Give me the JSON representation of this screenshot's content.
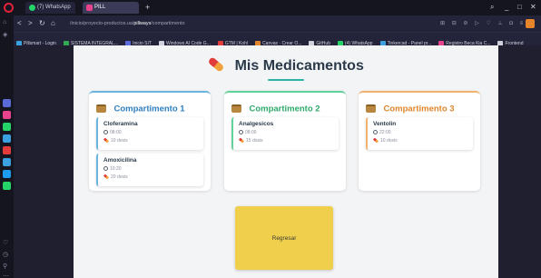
{
  "browser": {
    "tabs": [
      {
        "label": "(7) WhatsApp"
      },
      {
        "label": "PILL"
      }
    ],
    "new_tab_label": "+",
    "window_controls": {
      "search": "⌕",
      "minimize": "_",
      "maximize": "□",
      "close": "✕"
    },
    "nav": {
      "back": "<",
      "forward": ">",
      "reload": "↻",
      "home": "⌂"
    },
    "url_path_prefix": "/inicio/proyecto-productos.ua/",
    "url_host": "pillways",
    "url_path_suffix": "/compartimento",
    "bookmarks": [
      {
        "label": "Pillsmart - Login",
        "color": "#3aa0e0"
      },
      {
        "label": "SISTEMA INTEGRAL...",
        "color": "#33a852"
      },
      {
        "label": "Inicio SIT",
        "color": "#5a6bd8"
      },
      {
        "label": "Windows AI Code G...",
        "color": "#cfd2dc"
      },
      {
        "label": "GTM | Kohl",
        "color": "#e23b3b"
      },
      {
        "label": "Canvas · Crear O...",
        "color": "#e0852c"
      },
      {
        "label": "GitHub",
        "color": "#cfd2dc"
      },
      {
        "label": "(4) WhatsApp",
        "color": "#25d366"
      },
      {
        "label": "Tinkercad - Panel pr...",
        "color": "#3aa0e0"
      },
      {
        "label": "Registro Beca Kia C...",
        "color": "#e8438c"
      },
      {
        "label": "Frontend",
        "color": "#cfd2dc"
      }
    ],
    "sidebar_icons": [
      {
        "name": "messenger-icon",
        "color": "#5a6bd8"
      },
      {
        "name": "instagram-icon",
        "color": "#e8438c"
      },
      {
        "name": "whatsapp-icon",
        "color": "#25d366"
      },
      {
        "name": "telegram-icon",
        "color": "#3aa0e0"
      },
      {
        "name": "music-icon",
        "color": "#e23b3b"
      },
      {
        "name": "vk-icon",
        "color": "#3aa0e0"
      },
      {
        "name": "twitter-icon",
        "color": "#1d9bf0"
      },
      {
        "name": "spotify-icon",
        "color": "#25d366"
      }
    ]
  },
  "page": {
    "title": "Mis Medicamentos",
    "compartments": [
      {
        "title": "Compartimento 1",
        "medications": [
          {
            "name": "Cloferamina",
            "time": "08:00",
            "doses": "10 dosis"
          },
          {
            "name": "Amoxicilina",
            "time": "10:20",
            "doses": "20 dosis"
          }
        ]
      },
      {
        "title": "Compartimento 2",
        "medications": [
          {
            "name": "Analgesicos",
            "time": "08:00",
            "doses": "15 dosis"
          }
        ]
      },
      {
        "title": "Compartimento 3",
        "medications": [
          {
            "name": "Ventolin",
            "time": "22:00",
            "doses": "10 dosis"
          }
        ]
      }
    ],
    "back_button_label": "Regresar"
  },
  "colors": {
    "accent_teal": "#2bb5a8",
    "compartment_1": "#6cb4e0",
    "compartment_2": "#62d19a",
    "compartment_3": "#f0b26e",
    "button_yellow": "#efcf4c"
  }
}
